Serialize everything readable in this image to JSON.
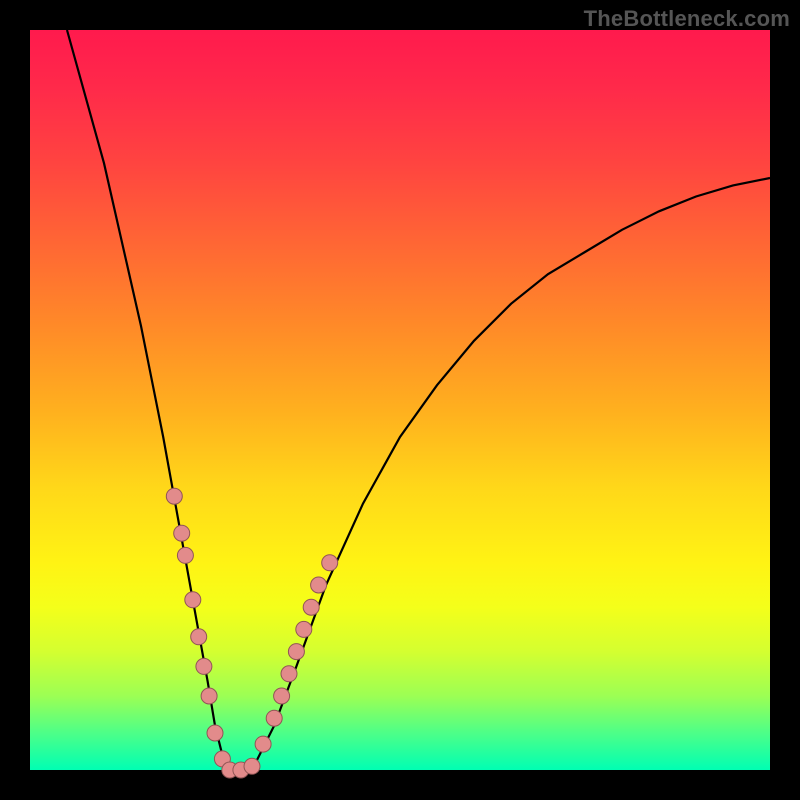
{
  "watermark": "TheBottleneck.com",
  "chart_data": {
    "type": "line",
    "title": "",
    "xlabel": "",
    "ylabel": "",
    "xlim": [
      0,
      100
    ],
    "ylim": [
      0,
      100
    ],
    "grid": false,
    "legend": false,
    "series": [
      {
        "name": "bottleneck-curve",
        "stroke": "#000000",
        "x": [
          5,
          10,
          15,
          18,
          20,
          22,
          24,
          25,
          26,
          27,
          28,
          30,
          33,
          36,
          40,
          45,
          50,
          55,
          60,
          65,
          70,
          75,
          80,
          85,
          90,
          95,
          100
        ],
        "values": [
          100,
          82,
          60,
          45,
          34,
          23,
          12,
          6,
          2,
          0,
          0,
          0,
          6,
          14,
          25,
          36,
          45,
          52,
          58,
          63,
          67,
          70,
          73,
          75.5,
          77.5,
          79,
          80
        ]
      }
    ],
    "markers": {
      "name": "scatter-points",
      "fill": "#e28b8b",
      "stroke": "#915555",
      "radius_px": 8,
      "x": [
        19.5,
        20.5,
        21.0,
        22.0,
        22.8,
        23.5,
        24.2,
        25.0,
        26.0,
        27.0,
        28.5,
        30.0,
        31.5,
        33.0,
        34.0,
        35.0,
        36.0,
        37.0,
        38.0,
        39.0,
        40.5
      ],
      "values": [
        37.0,
        32.0,
        29.0,
        23.0,
        18.0,
        14.0,
        10.0,
        5.0,
        1.5,
        0.0,
        0.0,
        0.5,
        3.5,
        7.0,
        10.0,
        13.0,
        16.0,
        19.0,
        22.0,
        25.0,
        28.0
      ]
    }
  }
}
